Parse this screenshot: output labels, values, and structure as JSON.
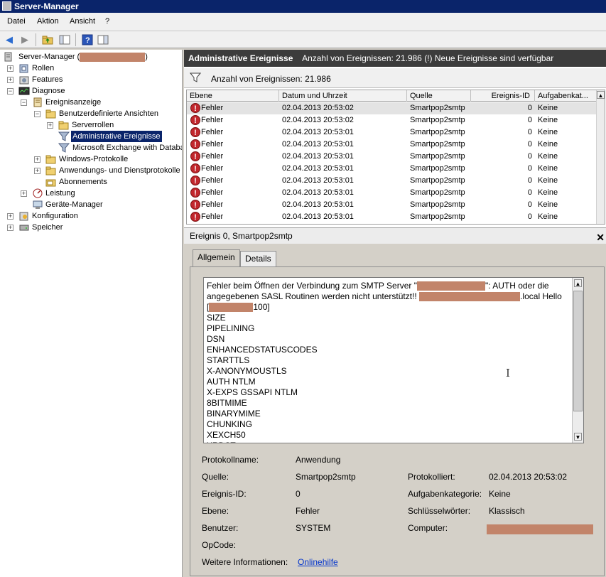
{
  "window": {
    "title": "Server-Manager"
  },
  "menu": {
    "items": [
      "Datei",
      "Aktion",
      "Ansicht",
      "?"
    ]
  },
  "toolbar": {
    "buttons": [
      "back-arrow-icon",
      "forward-arrow-icon",
      "up-folder-icon",
      "show-tree-icon",
      "help-icon",
      "properties-icon"
    ]
  },
  "tree": {
    "items": [
      {
        "label": "Server-Manager (",
        "suffix": ")"
      },
      {
        "label": "Rollen"
      },
      {
        "label": "Features"
      },
      {
        "label": "Diagnose"
      },
      {
        "label": "Ereignisanzeige"
      },
      {
        "label": "Benutzerdefinierte Ansichten"
      },
      {
        "label": "Serverrollen"
      },
      {
        "label": "Administrative Ereignisse"
      },
      {
        "label": "Microsoft Exchange with Databa"
      },
      {
        "label": "Windows-Protokolle"
      },
      {
        "label": "Anwendungs- und Dienstprotokolle"
      },
      {
        "label": "Abonnements"
      },
      {
        "label": "Leistung"
      },
      {
        "label": "Geräte-Manager"
      },
      {
        "label": "Konfiguration"
      },
      {
        "label": "Speicher"
      }
    ]
  },
  "header": {
    "title": "Administrative Ereignisse",
    "info": "Anzahl von Ereignissen: 21.986 (!) Neue Ereignisse sind verfügbar"
  },
  "filter": {
    "text": "Anzahl von Ereignissen: 21.986"
  },
  "grid": {
    "columns": [
      "Ebene",
      "Datum und Uhrzeit",
      "Quelle",
      "Ereignis-ID",
      "Aufgabenkat..."
    ],
    "rows": [
      [
        "Fehler",
        "02.04.2013 20:53:02",
        "Smartpop2smtp",
        "0",
        "Keine"
      ],
      [
        "Fehler",
        "02.04.2013 20:53:02",
        "Smartpop2smtp",
        "0",
        "Keine"
      ],
      [
        "Fehler",
        "02.04.2013 20:53:01",
        "Smartpop2smtp",
        "0",
        "Keine"
      ],
      [
        "Fehler",
        "02.04.2013 20:53:01",
        "Smartpop2smtp",
        "0",
        "Keine"
      ],
      [
        "Fehler",
        "02.04.2013 20:53:01",
        "Smartpop2smtp",
        "0",
        "Keine"
      ],
      [
        "Fehler",
        "02.04.2013 20:53:01",
        "Smartpop2smtp",
        "0",
        "Keine"
      ],
      [
        "Fehler",
        "02.04.2013 20:53:01",
        "Smartpop2smtp",
        "0",
        "Keine"
      ],
      [
        "Fehler",
        "02.04.2013 20:53:01",
        "Smartpop2smtp",
        "0",
        "Keine"
      ],
      [
        "Fehler",
        "02.04.2013 20:53:01",
        "Smartpop2smtp",
        "0",
        "Keine"
      ],
      [
        "Fehler",
        "02.04.2013 20:53:01",
        "Smartpop2smtp",
        "0",
        "Keine"
      ]
    ]
  },
  "detail": {
    "title": "Ereignis 0, Smartpop2smtp",
    "tabs": [
      "Allgemein",
      "Details"
    ],
    "message": {
      "line1_a": "Fehler beim Öffnen der Verbindung zum SMTP Server \"",
      "line1_b": "\": AUTH oder die",
      "line2_a": "angegebenen SASL Routinen werden nicht unterstützt!! ",
      "line2_b": ".local Hello",
      "line3_a": "[",
      "line3_b": "100]",
      "lines": [
        "SIZE",
        "PIPELINING",
        "DSN",
        "ENHANCEDSTATUSCODES",
        "STARTTLS",
        "X-ANONYMOUSTLS",
        "AUTH NTLM",
        "X-EXPS GSSAPI NTLM",
        "8BITMIME",
        "BINARYMIME",
        "CHUNKING",
        "XEXCH50",
        "XRDST"
      ]
    },
    "props": {
      "protokollname_label": "Protokollname:",
      "protokollname": "Anwendung",
      "quelle_label": "Quelle:",
      "quelle": "Smartpop2smtp",
      "protokolliert_label": "Protokolliert:",
      "protokolliert": "02.04.2013 20:53:02",
      "ereignisid_label": "Ereignis-ID:",
      "ereignisid": "0",
      "aufgabenkategorie_label": "Aufgabenkategorie:",
      "aufgabenkategorie": "Keine",
      "ebene_label": "Ebene:",
      "ebene": "Fehler",
      "schluesselwoerter_label": "Schlüsselwörter:",
      "schluesselwoerter": "Klassisch",
      "benutzer_label": "Benutzer:",
      "benutzer": "SYSTEM",
      "computer_label": "Computer:",
      "opcode_label": "OpCode:",
      "weitere_label": "Weitere Informationen:",
      "weitere_link": "Onlinehilfe"
    }
  },
  "colors": {
    "header_bg": "#3c3c3c",
    "selection": "#0a246a",
    "error": "#c1272d",
    "redaction": "#c2846a"
  }
}
